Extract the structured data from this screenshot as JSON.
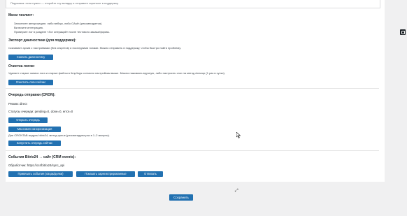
{
  "top_hint": "Подсказка: если нужно — откройте эту вкладку и отправьте скриншот в поддержку.",
  "checklist": {
    "title": "Мини чеклист:",
    "items": [
      "Заполните авторизацию: либо вебхук, либо OAuth (рекомендуется).",
      "Включите интеграцию.",
      "Проверьте лог в разделе «Лог операций» после тестового заказа/формы."
    ]
  },
  "diagnostics": {
    "title": "Экспорт диагностики (для поддержки):",
    "desc": "Скачивает архив с настройками (без секретов) и последними логами. Можно отправить в поддержку, чтобы быстро найти проблему.",
    "button": "Скачать диагностику"
  },
  "logs_cleanup": {
    "title": "Очистка логов:",
    "desc": "Удаляет старые записи лога и старые файлы в /tmp/logs согласно настройкам выше. Можно нажимать вручную, либо настроить cron на метод cleanup (1 раз в сутки).",
    "button": "Очистить логи сейчас"
  },
  "queue": {
    "title": "Очередь отправки (CRON):",
    "mode": "Режим: direct",
    "statuses": "Статусы очереди: pending=0, done=0, error=0",
    "open_button": "Открыть очередь",
    "sync_button": "Массовая синхронизация",
    "cron_note": "Для CRONTAB модуль bitrix24, метод queue (рекомендуем раз в 1–2 минуты).",
    "run_button": "Запустить очередь сейчас"
  },
  "events": {
    "title": "События Bitrix24 → сайт (CRM events):",
    "handler": "Обработчик: https://ocr/bitrix24/sync_api",
    "bind_button": "Привязать события (сводк/делки)",
    "show_button": "Показать зарегистрированные",
    "unbind_button": "Отвязать"
  },
  "save_button": "Сохранить"
}
